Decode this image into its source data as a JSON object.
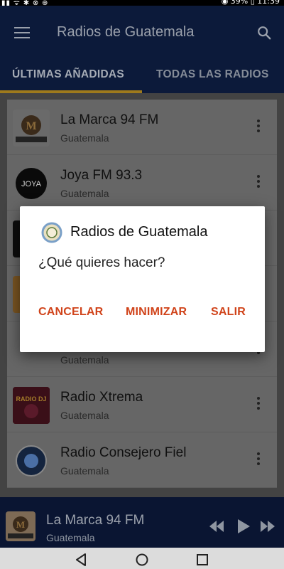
{
  "app": {
    "title": "Radios de Guatemala",
    "status_right": "◉ 39% ▯ 11:39"
  },
  "tabs": [
    {
      "label": "ÚLTIMAS AÑADIDAS",
      "active": true
    },
    {
      "label": "TODAS LAS RADIOS",
      "active": false
    }
  ],
  "stations": [
    {
      "name": "La Marca 94 FM",
      "country": "Guatemala",
      "logo_text": "LA MARCA"
    },
    {
      "name": "Joya FM 93.3",
      "country": "Guatemala",
      "logo_text": "JOYA"
    },
    {
      "name": "",
      "country": "",
      "logo_text": ""
    },
    {
      "name": "",
      "country": "",
      "logo_text": ""
    },
    {
      "name": "",
      "country": "Guatemala",
      "logo_text": ""
    },
    {
      "name": "Radio Xtrema",
      "country": "Guatemala",
      "logo_text": "RADIO DJ"
    },
    {
      "name": "Radio Consejero Fiel",
      "country": "Guatemala",
      "logo_text": ""
    }
  ],
  "player": {
    "name": "La Marca 94 FM",
    "country": "Guatemala"
  },
  "dialog": {
    "title": "Radios de Guatemala",
    "message": "¿Qué quieres hacer?",
    "buttons": {
      "cancel": "CANCELAR",
      "minimize": "MINIMIZAR",
      "exit": "SALIR"
    }
  },
  "colors": {
    "appbar": "#0c1a3a",
    "accent": "#9e7a1c",
    "dialog_button": "#d0431a"
  }
}
